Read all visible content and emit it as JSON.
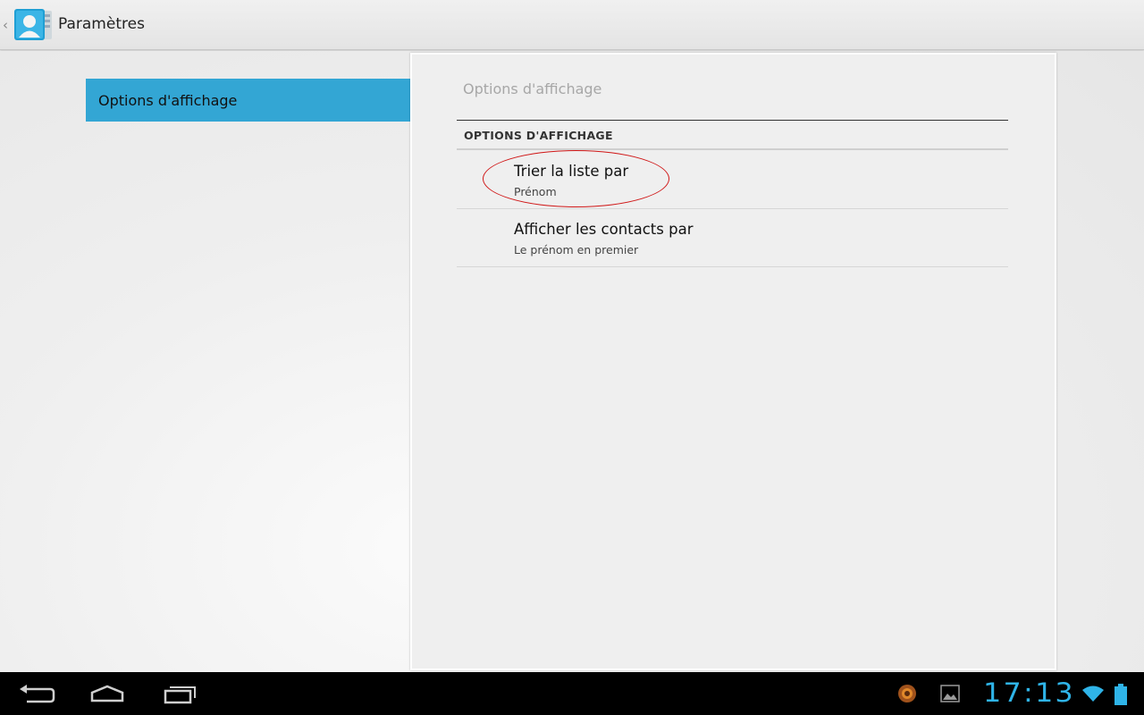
{
  "action_bar": {
    "title": "Paramètres",
    "up_caret": "‹"
  },
  "headers": [
    {
      "label": "Options d'affichage",
      "selected": true
    }
  ],
  "pane": {
    "breadcrumb": "Options d'affichage",
    "category": "OPTIONS D'AFFICHAGE",
    "preferences": [
      {
        "title": "Trier la liste par",
        "summary": "Prénom"
      },
      {
        "title": "Afficher les contacts par",
        "summary": "Le prénom en premier"
      }
    ]
  },
  "system_bar": {
    "clock": "17:13",
    "icons": [
      "back-icon",
      "home-icon",
      "recent-apps-icon",
      "notification-app-icon",
      "image-notification-icon",
      "wifi-icon",
      "battery-icon"
    ]
  },
  "colors": {
    "accent": "#33a6d4",
    "clock": "#2fb4e8",
    "annotation": "#d01818"
  }
}
